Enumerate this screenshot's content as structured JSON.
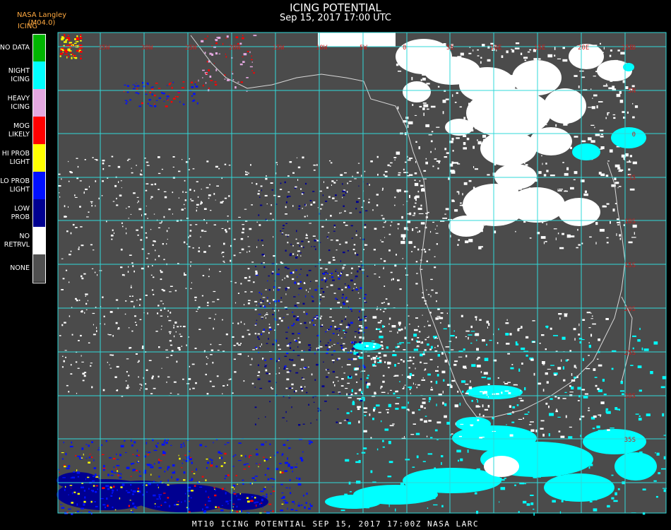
{
  "header": {
    "title": "ICING POTENTIAL",
    "subtitle": "Sep 15, 2017 17:00 UTC",
    "producer": "NASA Langley (M04.0)",
    "product": "ICING"
  },
  "legend": [
    {
      "label": "NO DATA",
      "color": "#00b400"
    },
    {
      "label": "NIGHT\nICING",
      "color": "#00ffff"
    },
    {
      "label": "HEAVY\nICING",
      "color": "#e4a8e0"
    },
    {
      "label": "MOG\nLIKELY",
      "color": "#ff0000"
    },
    {
      "label": "HI PROB\nLIGHT",
      "color": "#ffff00"
    },
    {
      "label": "LO PROB\nLIGHT",
      "color": "#0010ff"
    },
    {
      "label": "LOW\nPROB",
      "color": "#000090"
    },
    {
      "label": "NO\nRETRVL",
      "color": "#ffffff"
    },
    {
      "label": "NONE",
      "color": "#505050"
    }
  ],
  "map": {
    "background_color": "#4b4b4b",
    "grid_color": "#30d8d8",
    "label_color": "#c81e1e",
    "lon_labels": [
      "35W",
      "30W",
      "25W",
      "20W",
      "15W",
      "10W",
      "5W",
      "0",
      "5E",
      "10E",
      "15E",
      "20E",
      "25E",
      "30E",
      "35E"
    ],
    "lat_labels": [
      "0",
      "5N",
      "0",
      "5S",
      "10S",
      "15S",
      "20S",
      "25S",
      "30S",
      "35S"
    ]
  },
  "footer": {
    "text": "MT10  ICING POTENTIAL   SEP 15, 2017 17:00Z   NASA LARC"
  }
}
